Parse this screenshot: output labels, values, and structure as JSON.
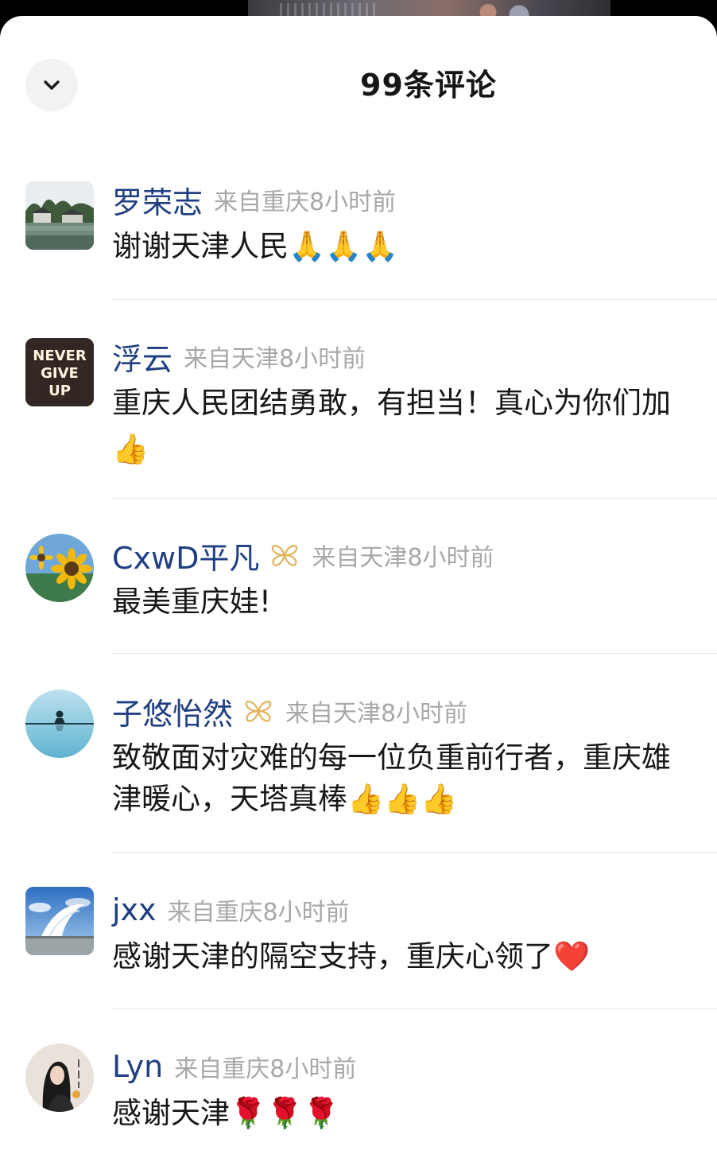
{
  "header": {
    "title": "99条评论",
    "collapse_icon": "chevron-down-icon"
  },
  "comments": [
    {
      "name": "罗荣志",
      "location": "来自重庆",
      "time": "8小时前",
      "lines": [
        "谢谢天津人民🙏🙏🙏"
      ],
      "badge": false,
      "avatar": "landscape-avatar"
    },
    {
      "name": "浮云",
      "location": "来自天津",
      "time": "8小时前",
      "lines": [
        "重庆人民团结勇敢，有担当！真心为你们加",
        "👍"
      ],
      "badge": false,
      "avatar": "never-give-up-avatar",
      "avatar_text": [
        "NEVER",
        "GIVE",
        "UP"
      ]
    },
    {
      "name": "CxwD平凡",
      "location": "来自天津",
      "time": "8小时前",
      "lines": [
        "最美重庆娃!"
      ],
      "badge": true,
      "avatar": "sunflower-avatar"
    },
    {
      "name": "子悠怡然",
      "location": "来自天津",
      "time": "8小时前",
      "lines": [
        "致敬面对灾难的每一位负重前行者，重庆雄",
        "津暖心，天塔真棒👍👍👍"
      ],
      "badge": true,
      "avatar": "meditation-avatar"
    },
    {
      "name": "jxx",
      "location": "来自重庆",
      "time": "8小时前",
      "lines": [
        "感谢天津的隔空支持，重庆心领了❤️"
      ],
      "badge": false,
      "avatar": "stadium-avatar"
    },
    {
      "name": "Lyn",
      "location": "来自重庆",
      "time": "8小时前",
      "lines": [
        "感谢天津🌹🌹🌹"
      ],
      "badge": false,
      "avatar": "portrait-avatar"
    }
  ],
  "colors": {
    "name": "#1f3f82",
    "meta": "#a8a8a8",
    "text": "#171717",
    "badge": "#e3b35a",
    "divider": "#e7e7e7"
  }
}
